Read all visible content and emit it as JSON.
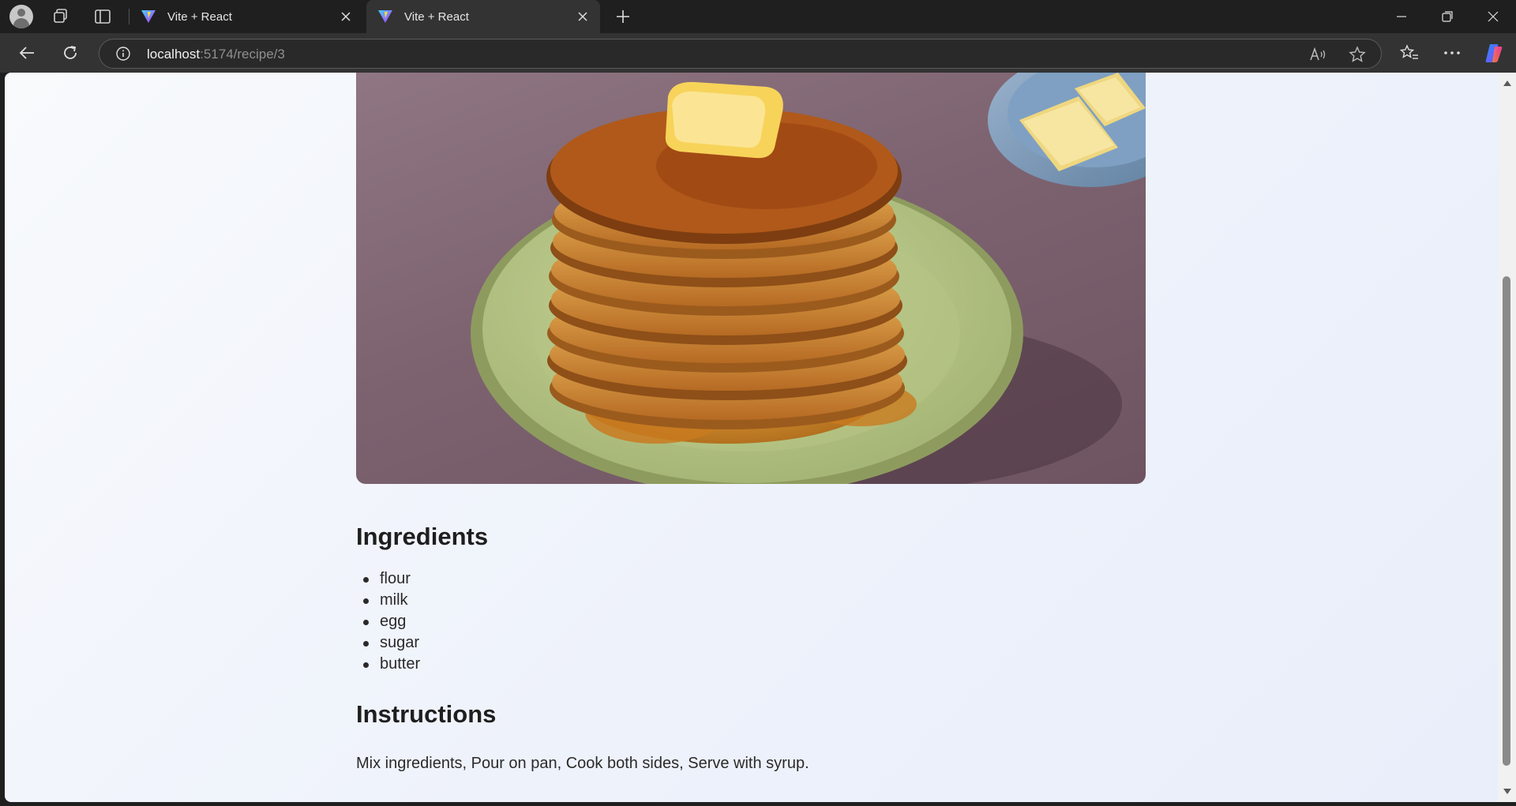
{
  "browser": {
    "tabs": [
      {
        "title": "Vite + React",
        "active": false
      },
      {
        "title": "Vite + React",
        "active": true
      }
    ],
    "url_host": "localhost",
    "url_path": ":5174/recipe/3",
    "icons": {
      "profile": "profile-avatar-icon",
      "workspaces": "workspaces-icon",
      "tab_actions": "vertical-tabs-icon",
      "favicon": "vite-logo-icon",
      "close": "close-icon",
      "new_tab": "plus-icon",
      "minimize": "minimize-icon",
      "restore": "restore-icon",
      "window_close": "close-icon",
      "back": "back-arrow-icon",
      "refresh": "refresh-icon",
      "site_info": "info-icon",
      "read_aloud": "read-aloud-icon",
      "favorite": "star-icon",
      "favorites": "favorites-icon",
      "more": "more-icon",
      "copilot": "copilot-icon"
    }
  },
  "recipe": {
    "image_alt": "Stack of pancakes with butter and syrup",
    "ingredients_heading": "Ingredients",
    "ingredients": [
      "flour",
      "milk",
      "egg",
      "sugar",
      "butter"
    ],
    "instructions_heading": "Instructions",
    "instructions": "Mix ingredients, Pour on pan, Cook both sides, Serve with syrup."
  },
  "colors": {
    "chrome_dark": "#1f1f1f",
    "chrome_toolbar": "#333333",
    "page_bg": "#f4f7fd",
    "text": "#1e1e1e"
  }
}
